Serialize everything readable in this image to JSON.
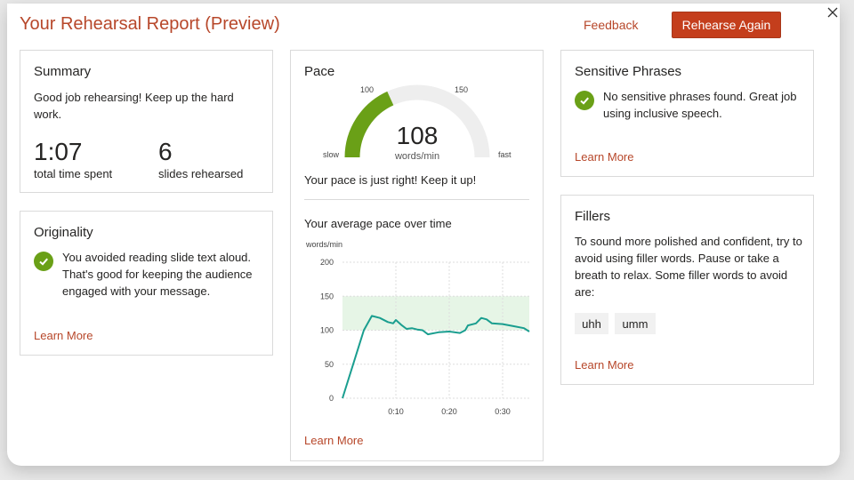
{
  "header": {
    "title": "Your Rehearsal Report (Preview)",
    "feedback_label": "Feedback",
    "rehearse_label": "Rehearse Again",
    "close_icon": "close-icon"
  },
  "summary": {
    "title": "Summary",
    "message": "Good job rehearsing! Keep up the hard work.",
    "time_value": "1:07",
    "time_label": "total time spent",
    "slides_value": "6",
    "slides_label": "slides rehearsed"
  },
  "originality": {
    "title": "Originality",
    "message": "You avoided reading slide text aloud. That's good for keeping the audience engaged with your message.",
    "learn_more": "Learn More"
  },
  "pace": {
    "title": "Pace",
    "gauge": {
      "value": "108",
      "unit": "words/min",
      "label_slow": "slow",
      "label_fast": "fast",
      "mark_low": "100",
      "mark_high": "150",
      "fill_color": "#6aa017",
      "track_color": "#eeeeee"
    },
    "message": "Your pace is just right! Keep it up!",
    "chart_title": "Your average pace over time",
    "learn_more": "Learn More"
  },
  "sensitive": {
    "title": "Sensitive Phrases",
    "message": "No sensitive phrases found. Great job using inclusive speech.",
    "learn_more": "Learn More"
  },
  "fillers": {
    "title": "Fillers",
    "message": "To sound more polished and confident, try to avoid using filler words. Pause or take a breath to relax. Some filler words to avoid are:",
    "words": [
      "uhh",
      "umm"
    ],
    "learn_more": "Learn More"
  },
  "colors": {
    "accent": "#b7472a",
    "button": "#c43e1c",
    "check": "#6aa017",
    "line": "#1a9e8f",
    "band": "#e6f5e6"
  },
  "chart_data": {
    "type": "line",
    "ylabel": "words/min",
    "ylim": [
      0,
      200
    ],
    "yticks": [
      0,
      50,
      100,
      150,
      200
    ],
    "xlim": [
      0,
      35
    ],
    "xticks": [
      10,
      20,
      30
    ],
    "xtick_labels": [
      "0:10",
      "0:20",
      "0:30"
    ],
    "target_band": [
      100,
      150
    ],
    "grid": true,
    "series": [
      {
        "x": [
          0,
          2,
          4,
          5.5,
          7,
          8.5,
          9.5,
          10,
          11,
          12,
          13,
          14,
          15,
          16,
          18,
          20,
          22,
          23,
          23.5,
          25,
          26,
          27,
          28,
          30,
          32,
          34,
          35
        ],
        "y": [
          0,
          50,
          100,
          121,
          118,
          112,
          110,
          115,
          108,
          102,
          103,
          101,
          100,
          94,
          97,
          98,
          96,
          100,
          107,
          110,
          118,
          116,
          110,
          109,
          106,
          103,
          98
        ]
      }
    ]
  }
}
